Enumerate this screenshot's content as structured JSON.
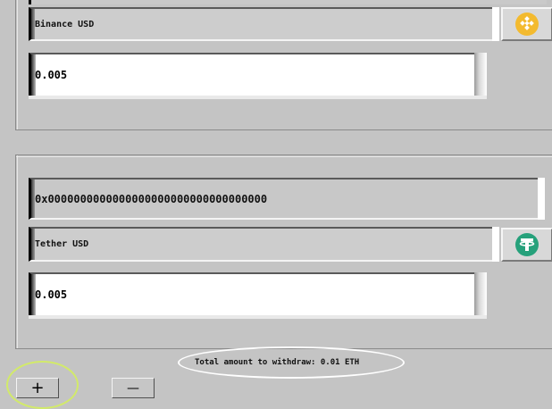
{
  "withdraw_entries": [
    {
      "token_name": "Binance USD",
      "token_icon": "binance-usd-icon",
      "amount": "0.005"
    },
    {
      "address": "0x0000000000000000000000000000000000",
      "token_name": "Tether USD",
      "token_icon": "tether-usd-icon",
      "amount": "0.005"
    }
  ],
  "footer": {
    "total_text": "Total amount to withdraw: 0.01 ETH",
    "add_label": "+",
    "remove_label": "—"
  },
  "colors": {
    "background": "#c4c4c4",
    "binance_gold": "#f3ba2f",
    "tether_green": "#26a17b",
    "highlight_ellipse_white": "#ffffff",
    "highlight_circle_yellow": "#d2ea6a"
  }
}
